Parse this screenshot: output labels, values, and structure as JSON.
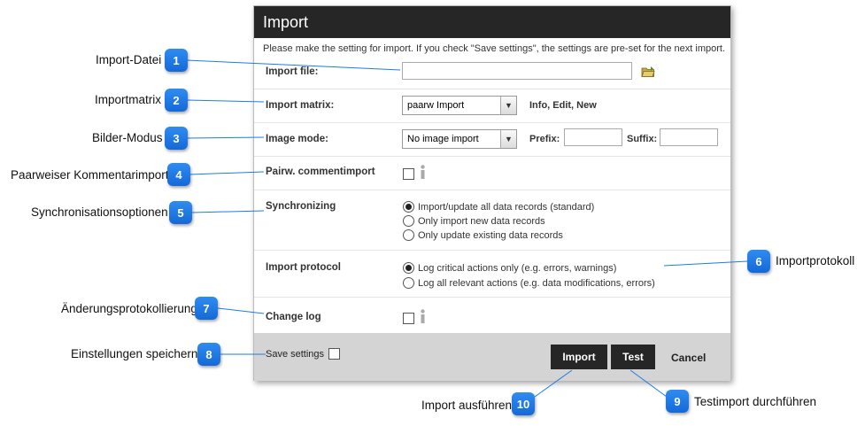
{
  "dialog": {
    "title": "Import",
    "intro": "Please make the setting for import. If you check \"Save settings\", the settings are pre-set for the next import.",
    "import_file": {
      "label": "Import file:",
      "value": "",
      "folder_icon": "folder-open-icon"
    },
    "import_matrix": {
      "label": "Import matrix:",
      "selected": "paarw Import",
      "hint": "Info, Edit, New"
    },
    "image_mode": {
      "label": "Image mode:",
      "selected": "No image import",
      "prefix_label": "Prefix:",
      "prefix_value": "",
      "suffix_label": "Suffix:",
      "suffix_value": ""
    },
    "pairwise": {
      "label": "Pairw. commentimport",
      "checked": false,
      "info_icon": "info-icon"
    },
    "synchronizing": {
      "label": "Synchronizing",
      "options": [
        {
          "label": "Import/update all data records (standard)",
          "selected": true
        },
        {
          "label": "Only import new data records",
          "selected": false
        },
        {
          "label": "Only update existing data records",
          "selected": false
        }
      ]
    },
    "import_protocol": {
      "label": "Import protocol",
      "options": [
        {
          "label": "Log critical actions only (e.g. errors, warnings)",
          "selected": true
        },
        {
          "label": "Log all relevant actions (e.g. data modifications, errors)",
          "selected": false
        }
      ]
    },
    "change_log": {
      "label": "Change log",
      "checked": false,
      "info_icon": "info-icon"
    },
    "footer": {
      "save_label": "Save settings",
      "save_checked": false,
      "import_label": "Import",
      "test_label": "Test",
      "cancel_label": "Cancel"
    }
  },
  "callouts": [
    {
      "number": "1",
      "text": "Import-Datei"
    },
    {
      "number": "2",
      "text": "Importmatrix"
    },
    {
      "number": "3",
      "text": "Bilder-Modus"
    },
    {
      "number": "4",
      "text": "Paarweiser Kommentarimport"
    },
    {
      "number": "5",
      "text": "Synchronisationsoptionen"
    },
    {
      "number": "6",
      "text": "Importprotokoll"
    },
    {
      "number": "7",
      "text": "Änderungsprotokollierung"
    },
    {
      "number": "8",
      "text": "Einstellungen speichern"
    },
    {
      "number": "9",
      "text": "Testimport durchführen"
    },
    {
      "number": "10",
      "text": "Import ausführen"
    }
  ],
  "colors": {
    "titlebar": "#262626",
    "badge": "#1e7be6",
    "footer": "#d4d4d4",
    "callout_line": "#1e7be6"
  }
}
